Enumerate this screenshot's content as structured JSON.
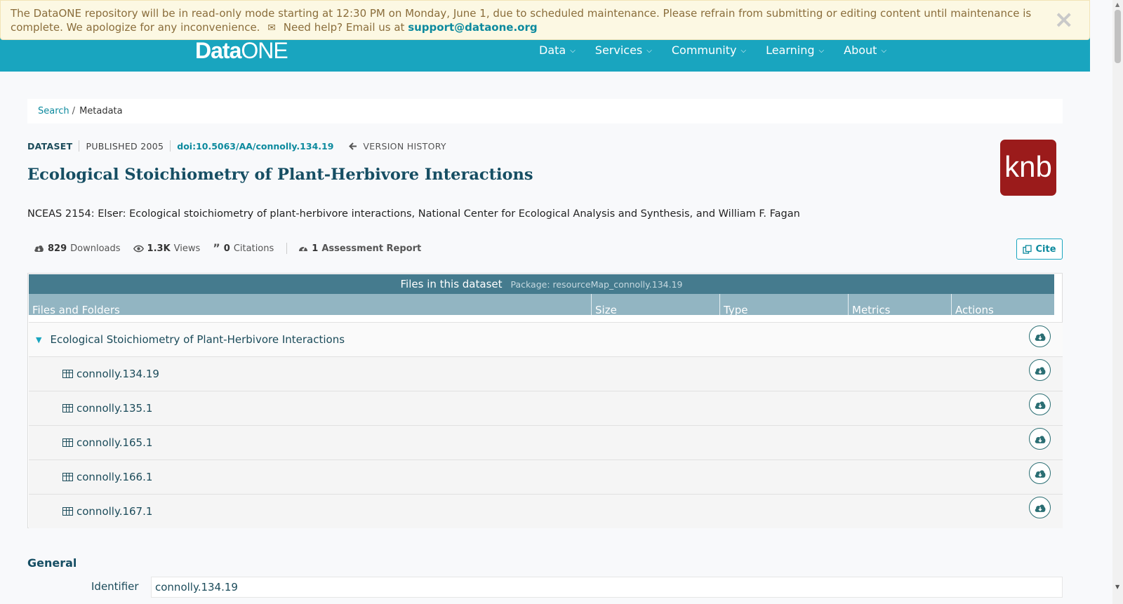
{
  "alert": {
    "message": "The DataONE repository will be in read-only mode starting at 12:30 PM on Monday, June 1, due to scheduled maintenance. Please refrain from submitting or editing content until maintenance is complete. We apologize for any inconvenience.",
    "help_text": "Need help? Email us at",
    "support_email": "support@dataone.org",
    "close_label": "×"
  },
  "header": {
    "logo_data": "Data",
    "logo_one": "ONE",
    "nav": [
      {
        "label": "Data"
      },
      {
        "label": "Services"
      },
      {
        "label": "Community"
      },
      {
        "label": "Learning"
      },
      {
        "label": "About"
      }
    ]
  },
  "breadcrumb": {
    "search": "Search",
    "separator": "/",
    "current": "Metadata"
  },
  "meta": {
    "type": "DATASET",
    "published": "PUBLISHED 2005",
    "doi": "doi:10.5063/AA/connolly.134.19",
    "version_history": "VERSION HISTORY"
  },
  "title": "Ecological Stoichiometry of Plant-Herbivore Interactions",
  "repository_logo": "knb",
  "citation": "NCEAS 2154: Elser: Ecological stoichiometry of plant-herbivore interactions, National Center for Ecological Analysis and Synthesis, and William F. Fagan",
  "metrics": {
    "downloads_count": "829",
    "downloads_label": "Downloads",
    "views_count": "1.3K",
    "views_label": "Views",
    "citations_count": "0",
    "citations_label": "Citations",
    "assessment_count": "1",
    "assessment_label": "Assessment Report"
  },
  "cite_button": "Cite",
  "files": {
    "header": "Files in this dataset",
    "package": "Package: resourceMap_connolly.134.19",
    "columns": [
      "Files and Folders",
      "Size",
      "Type",
      "Metrics",
      "Actions"
    ],
    "folder": "Ecological Stoichiometry of Plant-Herbivore Interactions",
    "items": [
      "connolly.134.19",
      "connolly.135.1",
      "connolly.165.1",
      "connolly.166.1",
      "connolly.167.1"
    ]
  },
  "general": {
    "heading": "General",
    "identifier_label": "Identifier",
    "identifier_value": "connolly.134.19"
  },
  "colors": {
    "header_bg": "#19a5bf",
    "accent": "#0d8a9e",
    "table_header": "#457b8e",
    "column_header": "#92b5c2",
    "knb_red": "#9b1b1b"
  }
}
